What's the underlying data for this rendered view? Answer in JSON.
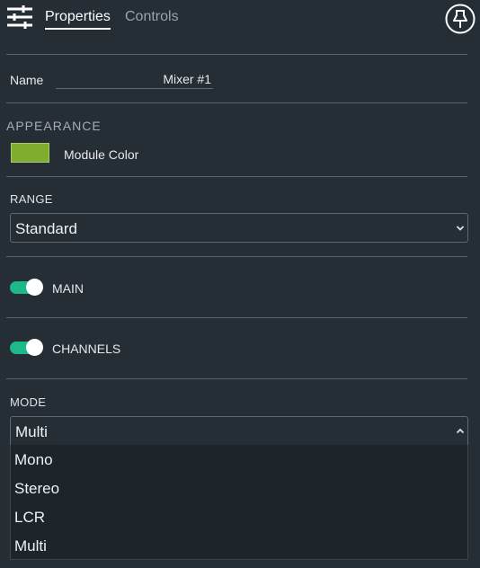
{
  "header": {
    "tabs": [
      {
        "label": "Properties",
        "active": true
      },
      {
        "label": "Controls",
        "active": false
      }
    ],
    "left_icon": "sliders-icon",
    "right_icon": "pin-icon"
  },
  "name_row": {
    "label": "Name",
    "value": "Mixer #1"
  },
  "appearance": {
    "title": "APPEARANCE",
    "color_label": "Module Color",
    "module_color": "#7fae2f"
  },
  "range": {
    "title": "RANGE",
    "selected": "Standard"
  },
  "toggles": [
    {
      "label": "MAIN",
      "on": true
    },
    {
      "label": "CHANNELS",
      "on": true
    }
  ],
  "mode": {
    "title": "MODE",
    "selected": "Multi",
    "options": [
      "Mono",
      "Stereo",
      "LCR",
      "Multi"
    ]
  },
  "colors": {
    "accent_toggle": "#1eb98a",
    "background": "#252d35",
    "dropdown_bg": "#1d242a"
  }
}
